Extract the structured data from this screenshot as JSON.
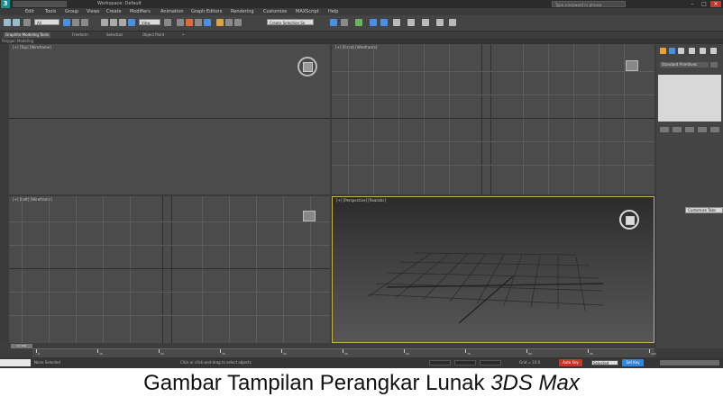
{
  "titlebar": {
    "app_logo": "3",
    "title": "Workspace: Default",
    "search_placeholder": "Type a keyword or phrase",
    "buttons": [
      "–",
      "□",
      "×"
    ]
  },
  "menu": [
    "Edit",
    "Tools",
    "Group",
    "Views",
    "Create",
    "Modifiers",
    "Animation",
    "Graph Editors",
    "Rendering",
    "Customize",
    "MAXScript",
    "Help"
  ],
  "toolbar": {
    "selection_filter": "All",
    "ref_coord": "View",
    "named_selection": "Create Selection Se"
  },
  "ribbon": {
    "tabs": [
      "Graphite Modeling Tools",
      "Freeform",
      "Selection",
      "Object Paint",
      "•"
    ],
    "sub_label": "Polygon Modeling"
  },
  "viewports": {
    "top": "[+] [Top] [Wireframe]",
    "front": "[+] [Front] [Wireframe]",
    "left": "[+] [Left] [Wireframe]",
    "perspective": "[+] [Perspective] [Realistic]"
  },
  "command_panel": {
    "dropdown": "Standard Primitives",
    "side_button": "Customize Tabs"
  },
  "timeline": {
    "slider": "0 / 100",
    "ticks": [
      "0",
      "10",
      "20",
      "30",
      "40",
      "50",
      "60",
      "70",
      "80",
      "90",
      "100"
    ]
  },
  "status": {
    "selected": "None Selected",
    "prompt": "Click or click-and-drag to select objects",
    "grid": "Grid = 10.0",
    "auto_key": "Auto Key",
    "set_key": "Set Key",
    "key_mode": "Selected"
  },
  "caption": {
    "normal": "Gambar Tampilan  Perangkar Lunak ",
    "italic": "3DS Max"
  }
}
